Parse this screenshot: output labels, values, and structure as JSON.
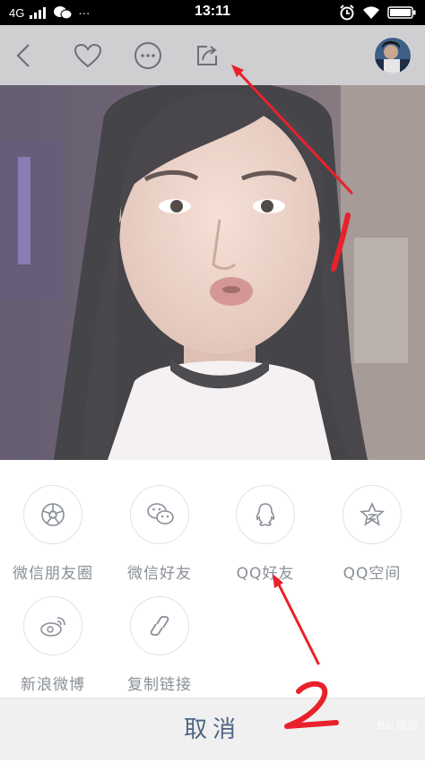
{
  "status_bar": {
    "network": "4G",
    "time": "13:11",
    "more": "···"
  },
  "header": {
    "icons": [
      "back-icon",
      "heart-icon",
      "more-icon",
      "share-icon",
      "avatar"
    ]
  },
  "share_sheet": {
    "items": [
      {
        "label": "微信朋友圈",
        "icon": "moments-icon"
      },
      {
        "label": "微信好友",
        "icon": "wechat-icon"
      },
      {
        "label": "QQ好友",
        "icon": "qq-icon"
      },
      {
        "label": "QQ空间",
        "icon": "qzone-icon"
      },
      {
        "label": "新浪微博",
        "icon": "weibo-icon"
      },
      {
        "label": "复制链接",
        "icon": "link-icon"
      }
    ],
    "cancel_label": "取消"
  },
  "annotations": {
    "mark_1": "1",
    "mark_2": "2"
  },
  "watermark": "Bai 经验",
  "colors": {
    "annotation_red": "#e8212b",
    "cancel_text": "#4f6583",
    "label_gray": "#8a8f98"
  }
}
